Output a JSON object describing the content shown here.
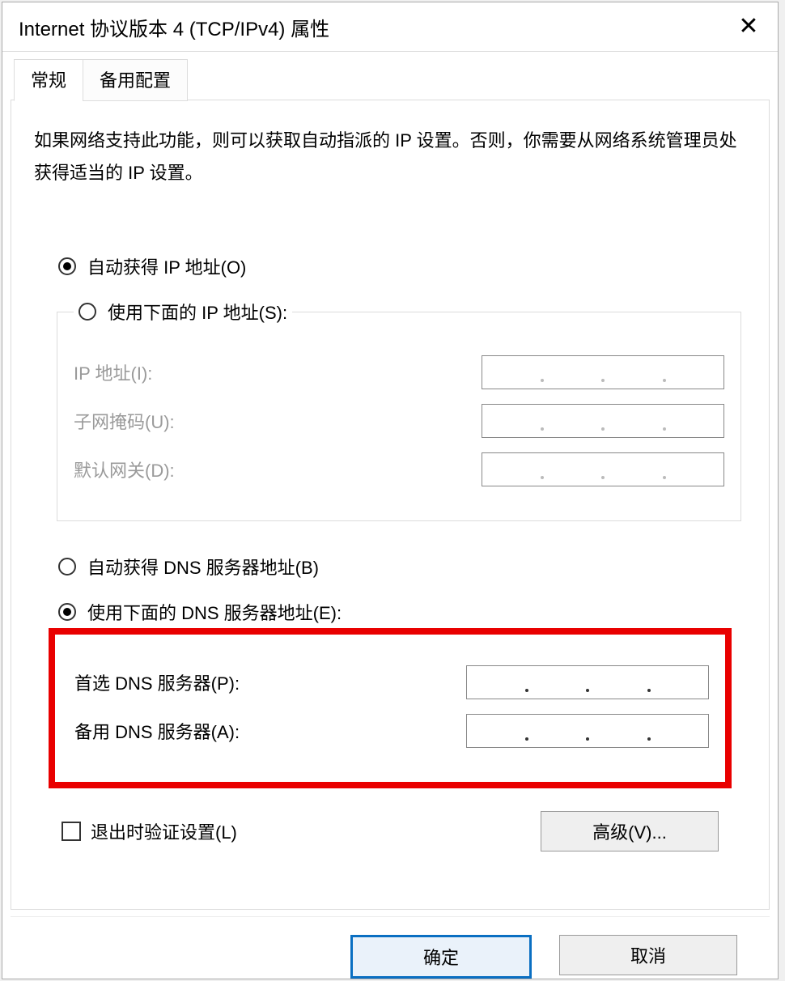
{
  "window": {
    "title": "Internet 协议版本 4 (TCP/IPv4) 属性"
  },
  "tabs": {
    "general": "常规",
    "alternate": "备用配置"
  },
  "desc": "如果网络支持此功能，则可以获取自动指派的 IP 设置。否则，你需要从网络系统管理员处获得适当的 IP 设置。",
  "ip": {
    "auto": "自动获得 IP 地址(O)",
    "manual": "使用下面的 IP 地址(S):",
    "addr": "IP 地址(I):",
    "mask": "子网掩码(U):",
    "gw": "默认网关(D):"
  },
  "dns": {
    "auto": "自动获得 DNS 服务器地址(B)",
    "manual": "使用下面的 DNS 服务器地址(E):",
    "primary": "首选 DNS 服务器(P):",
    "alt": "备用 DNS 服务器(A):"
  },
  "validate": "退出时验证设置(L)",
  "buttons": {
    "advanced": "高级(V)...",
    "ok": "确定",
    "cancel": "取消"
  }
}
